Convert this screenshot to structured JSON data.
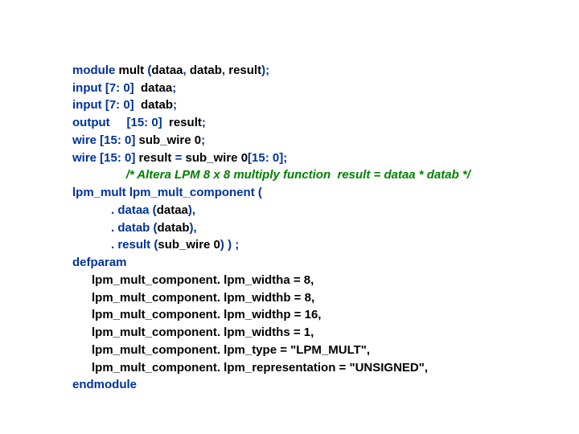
{
  "code": {
    "l1": {
      "kw1": "module",
      "t1": " mult ",
      "kw2": "(",
      "t2": "dataa",
      "kw3": ",",
      "t3": " datab",
      "kw4": ",",
      "t4": " result",
      "kw5": ");"
    },
    "l2": {
      "kw1": "input [7: 0]",
      "t1": "  dataa",
      "kw2": ";"
    },
    "l3": {
      "kw1": "input [7: 0]",
      "t1": "  datab",
      "kw2": ";"
    },
    "l4": {
      "kw1": "output     [15: 0]",
      "t1": "  result",
      "kw2": ";"
    },
    "l5": {
      "kw1": "wire [15: 0]",
      "t1": " sub_wire 0",
      "kw2": ";"
    },
    "l6": {
      "kw1": "wire [15: 0]",
      "t1": " result ",
      "kw2": "=",
      "t2": " sub_wire 0",
      "kw3": "[15: 0];"
    },
    "l7": {
      "c": "/* Altera LPM 8 x 8 multiply function  result = dataa * datab */"
    },
    "l8": {
      "kw1": "lpm_mult lpm_mult_component ("
    },
    "l9": {
      "kw1": ". dataa (",
      "t1": "dataa",
      "kw2": "),"
    },
    "l10": {
      "kw1": ". datab (",
      "t1": "datab",
      "kw2": "),"
    },
    "l11": {
      "kw1": ". result (",
      "t1": "sub_wire 0",
      "kw2": ") ) ;"
    },
    "l12": {
      "kw1": "defparam"
    },
    "l13": {
      "t1": "lpm_mult_component. lpm_widtha = 8,"
    },
    "l14": {
      "t1": "lpm_mult_component. lpm_widthb = 8,"
    },
    "l15": {
      "t1": "lpm_mult_component. lpm_widthp = 16,"
    },
    "l16": {
      "t1": "lpm_mult_component. lpm_widths = 1,"
    },
    "l17": {
      "t1": "lpm_mult_component. lpm_type = \"LPM_MULT\","
    },
    "l18": {
      "t1": "lpm_mult_component. lpm_representation = \"UNSIGNED\","
    },
    "l19": {
      "kw1": "endmodule"
    }
  }
}
